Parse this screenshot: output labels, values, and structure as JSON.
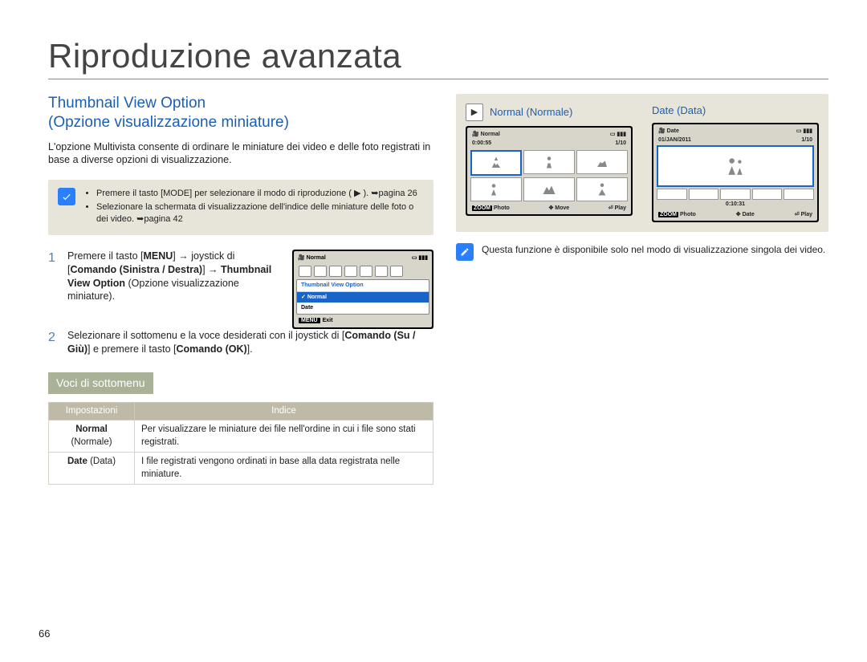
{
  "chapter_title": "Riproduzione avanzata",
  "section_heading_line1": "Thumbnail View Option",
  "section_heading_line2": "(Opzione visualizzazione miniature)",
  "intro": "L'opzione Multivista consente di ordinare le miniature dei video e delle foto registrati in base a diverse opzioni di visualizzazione.",
  "notebox": {
    "items": [
      "Premere il tasto [MODE] per selezionare il modo di riproduzione ( ▶ ). ➥pagina 26",
      "Selezionare la schermata di visualizzazione dell'indice delle miniature delle foto o dei video. ➥pagina 42"
    ]
  },
  "steps": [
    {
      "num": "1",
      "html": "Premere il tasto [<b>MENU</b>] → joystick di [<b>Comando (Sinistra / Destra)</b>] → <b>Thumbnail View Option</b> (Opzione visualizzazione miniature)."
    },
    {
      "num": "2",
      "html": "Selezionare il sottomenu e la voce desiderati con il joystick di [<b>Comando (Su / Giù)</b>] e premere il tasto [<b>Comando (OK)</b>]."
    }
  ],
  "mini_screen": {
    "mode_label": "Normal",
    "panel_title": "Thumbnail View Option",
    "rows": [
      "Normal",
      "Date"
    ],
    "exit": "Exit",
    "menu_tag": "MENU"
  },
  "sub_heading": "Voci di sottomenu",
  "table": {
    "head": {
      "col1": "Impostazioni",
      "col2": "Indice"
    },
    "rows": [
      {
        "label_html": "<b>Normal</b><br>(Normale)",
        "desc": "Per visualizzare le miniature dei file nell'ordine in cui i file sono stati registrati."
      },
      {
        "label_html": "<b>Date</b> (Data)",
        "desc": "I file registrati vengono ordinati in base alla data registrata nelle miniature."
      }
    ]
  },
  "right": {
    "normal_title": "Normal (Normale)",
    "date_title": "Date (Data)",
    "normal_screen": {
      "mode": "Normal",
      "time": "0:00:55",
      "count": "1/10",
      "footer": {
        "zoom": "ZOOM",
        "photo": "Photo",
        "move": "Move",
        "play": "Play"
      }
    },
    "date_screen": {
      "mode": "Date",
      "date": "01/JAN/2011",
      "count": "1/10",
      "time": "0:10:31",
      "footer": {
        "zoom": "ZOOM",
        "photo": "Photo",
        "date": "Date",
        "play": "Play"
      }
    },
    "bottom_note": "Questa funzione è disponibile solo nel modo di visualizzazione singola dei video."
  },
  "page_number": "66"
}
